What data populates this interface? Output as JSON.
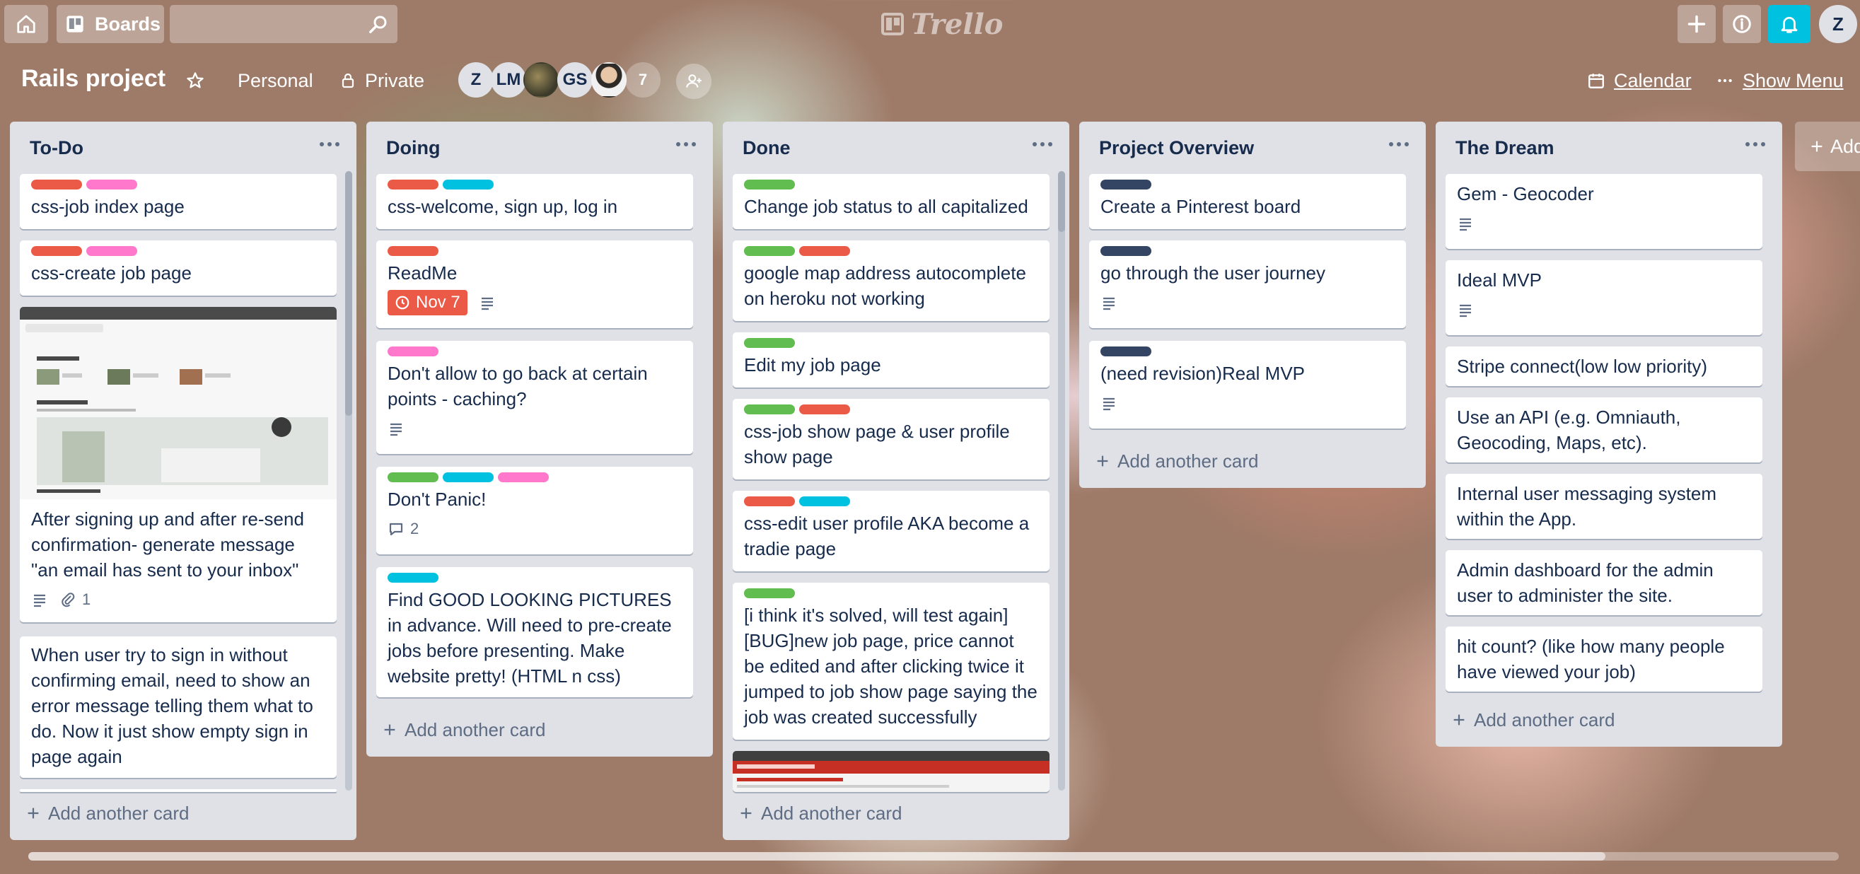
{
  "header": {
    "boards_label": "Boards",
    "search_placeholder": "",
    "logo_text": "Trello",
    "user_initial": "Z"
  },
  "board": {
    "title": "Rails project",
    "team": "Personal",
    "visibility": "Private",
    "members": [
      {
        "initials": "Z"
      },
      {
        "initials": "LM"
      },
      {
        "initials": ""
      },
      {
        "initials": "GS"
      },
      {
        "initials": ""
      },
      {
        "initials": "7"
      }
    ],
    "calendar_label": "Calendar",
    "menu_label": "Show Menu",
    "add_list_label": "Add"
  },
  "colors": {
    "red": "#eb5a46",
    "pink": "#ff78cb",
    "sky": "#00c2e0",
    "green": "#61bd4f",
    "black": "#344563",
    "notify": "#00c2e0"
  },
  "lists": [
    {
      "title": "To-Do",
      "add_label": "Add another card",
      "cards": [
        {
          "labels": [
            "red",
            "pink"
          ],
          "title": "css-job index page"
        },
        {
          "labels": [
            "red",
            "pink"
          ],
          "title": "css-create job page"
        },
        {
          "labels": [],
          "cover": "screenshot",
          "title": "After signing up and after re-send confirmation- generate message \"an email has sent to your inbox\"",
          "attachments": "1"
        },
        {
          "labels": [],
          "title": "When user try to sign in without confirming email, need to show an error message telling them what to do. Now it just show empty sign in page again"
        }
      ]
    },
    {
      "title": "Doing",
      "add_label": "Add another card",
      "cards": [
        {
          "labels": [
            "red",
            "sky"
          ],
          "title": "css-welcome, sign up, log in"
        },
        {
          "labels": [
            "red"
          ],
          "title": "ReadMe",
          "due": "Nov 7"
        },
        {
          "labels": [
            "pink"
          ],
          "title": "Don't allow to go back at certain points - caching?"
        },
        {
          "labels": [
            "green",
            "sky",
            "pink"
          ],
          "title": "Don't Panic!",
          "comments": "2"
        },
        {
          "labels": [
            "sky"
          ],
          "title": "Find GOOD LOOKING PICTURES in advance. Will need to pre-create jobs before presenting. Make website pretty! (HTML n css)"
        }
      ]
    },
    {
      "title": "Done",
      "add_label": "Add another card",
      "cards": [
        {
          "labels": [
            "green"
          ],
          "title": "Change job status to all capitalized"
        },
        {
          "labels": [
            "green",
            "red"
          ],
          "title": "google map address autocomplete on heroku not working"
        },
        {
          "labels": [
            "green"
          ],
          "title": "Edit my job page"
        },
        {
          "labels": [
            "green",
            "red"
          ],
          "title": "css-job show page & user profile show page"
        },
        {
          "labels": [
            "red",
            "sky"
          ],
          "title": "css-edit user profile AKA become a tradie page"
        },
        {
          "labels": [
            "green"
          ],
          "title": "[i think it's solved, will test again][BUG]new job page, price cannot be edited and after clicking twice it jumped to job show page saying the job was created successfully"
        },
        {
          "labels": [],
          "cover": "error",
          "title": ""
        }
      ]
    },
    {
      "title": "Project Overview",
      "add_label": "Add another card",
      "cards": [
        {
          "labels": [
            "black"
          ],
          "title": "Create a Pinterest board"
        },
        {
          "labels": [
            "black"
          ],
          "title": "go through the user journey"
        },
        {
          "labels": [
            "black"
          ],
          "title": "(need revision)Real MVP"
        }
      ]
    },
    {
      "title": "The Dream",
      "add_label": "Add another card",
      "cards": [
        {
          "labels": [],
          "title": "Gem - Geocoder"
        },
        {
          "labels": [],
          "title": "Ideal MVP"
        },
        {
          "labels": [],
          "title": "Stripe connect(low low priority)"
        },
        {
          "labels": [],
          "title": "Use an API (e.g. Omniauth, Geocoding, Maps, etc)."
        },
        {
          "labels": [],
          "title": "Internal user messaging system within the App."
        },
        {
          "labels": [],
          "title": "Admin dashboard for the admin user to administer the site."
        },
        {
          "labels": [],
          "title": "hit count? (like how many people have viewed your job)"
        }
      ]
    }
  ]
}
